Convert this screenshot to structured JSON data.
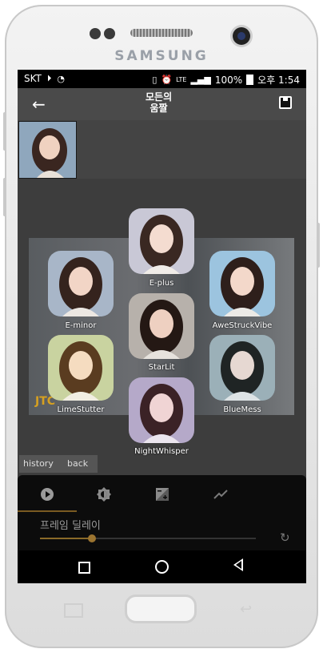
{
  "device": {
    "brand": "SAMSUNG"
  },
  "status": {
    "carrier": "SKT",
    "network": "LTE",
    "battery": "100%",
    "time": "오후 1:54"
  },
  "appbar": {
    "back_icon": "arrow-left-icon",
    "logo_lines": [
      "모든의",
      "움짤"
    ],
    "save_icon": "save-icon"
  },
  "filters": [
    {
      "label": "E-minor",
      "tint": "#a8b6c8"
    },
    {
      "label": "E-plus",
      "tint": "#c9c8d6"
    },
    {
      "label": "AweStruckVibe",
      "tint": "#9cc4df"
    },
    {
      "label": "StarLit",
      "tint": "#b7b1ab"
    },
    {
      "label": "LimeStutter",
      "tint": "#c9d3a0"
    },
    {
      "label": "BlueMess",
      "tint": "#9bb0b8"
    },
    {
      "label": "NightWhisper",
      "tint": "#b5a9c9"
    }
  ],
  "watermark": "JTC",
  "chips": {
    "history": "history",
    "back": "back"
  },
  "panel": {
    "tabs": [
      "play-icon",
      "brightness-icon",
      "exposure-icon",
      "trend-icon"
    ],
    "label": "프레임 딜레이",
    "slider_value": 0.24,
    "reset_icon": "reset-icon"
  },
  "colors": {
    "accent": "#8a6a28",
    "panel_bg": "#0c0c0c",
    "screen_bg": "#3a3a3a"
  }
}
